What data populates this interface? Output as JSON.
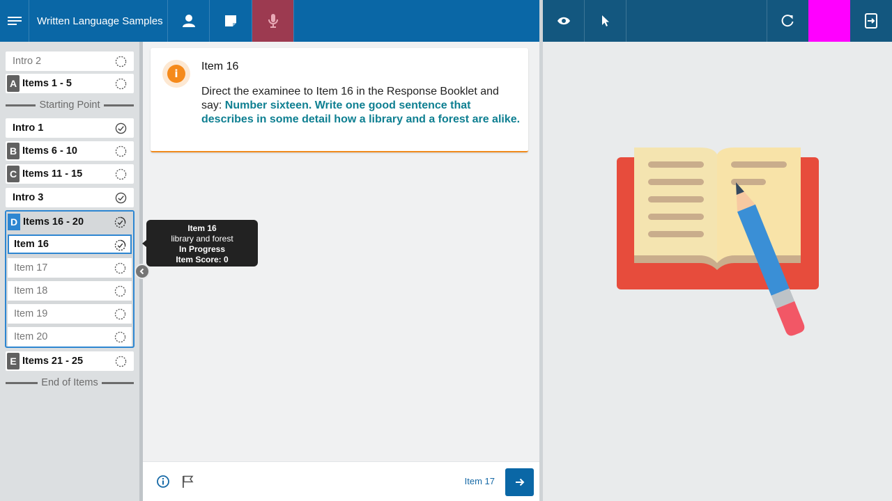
{
  "app": {
    "title": "Written Language Samples"
  },
  "toolbar": {
    "menu_icon": "hamburger-menu-icon",
    "person_icon": "person-icon",
    "note_icon": "sticky-note-icon",
    "mic_icon": "microphone-icon",
    "eye_icon": "eye-icon",
    "pointer_icon": "cursor-pointer-icon",
    "refresh_icon": "refresh-icon",
    "exit_icon": "exit-screen-icon",
    "mic_active_color": "#9c3a50",
    "swatch_color": "#ff00ff"
  },
  "sidebar": {
    "items": [
      {
        "label": "Intro 2",
        "status": "not-started"
      },
      {
        "badge": "A",
        "label": "Items 1 - 5",
        "status": "not-started"
      },
      {
        "label": "Intro 1",
        "status": "complete"
      },
      {
        "badge": "B",
        "label": "Items 6 - 10",
        "status": "not-started"
      },
      {
        "badge": "C",
        "label": "Items 11 - 15",
        "status": "not-started"
      },
      {
        "label": "Intro 3",
        "status": "complete"
      },
      {
        "badge": "E",
        "label": "Items 21 - 25",
        "status": "not-started"
      }
    ],
    "starting_point": "Starting Point",
    "end_of_items": "End of Items",
    "group": {
      "badge": "D",
      "label": "Items 16 - 20",
      "status": "in-progress",
      "items": [
        {
          "label": "Item 16",
          "status": "in-progress",
          "active": true
        },
        {
          "label": "Item 17",
          "status": "not-started"
        },
        {
          "label": "Item 18",
          "status": "not-started"
        },
        {
          "label": "Item 19",
          "status": "not-started"
        },
        {
          "label": "Item 20",
          "status": "not-started"
        }
      ]
    }
  },
  "tooltip": {
    "title": "Item 16",
    "subtitle": "library and forest",
    "status": "In Progress",
    "score": "Item Score: 0"
  },
  "card": {
    "title": "Item 16",
    "instruction": "Direct the examinee to Item 16 in the Response Booklet and say: ",
    "say_text": "Number sixteen. Write one good sentence that describes in some detail how a library and a forest are alike."
  },
  "footer": {
    "next_label": "Item 17",
    "info_icon": "info-icon",
    "flag_icon": "flag-icon",
    "next_icon": "arrow-right-icon"
  },
  "stimulus": {
    "image": "book-and-pencil-illustration"
  },
  "colors": {
    "primary": "#0a67a6",
    "accent_orange": "#f58a1b",
    "say_teal": "#0e7f91",
    "active_blue": "#2d86d1"
  }
}
